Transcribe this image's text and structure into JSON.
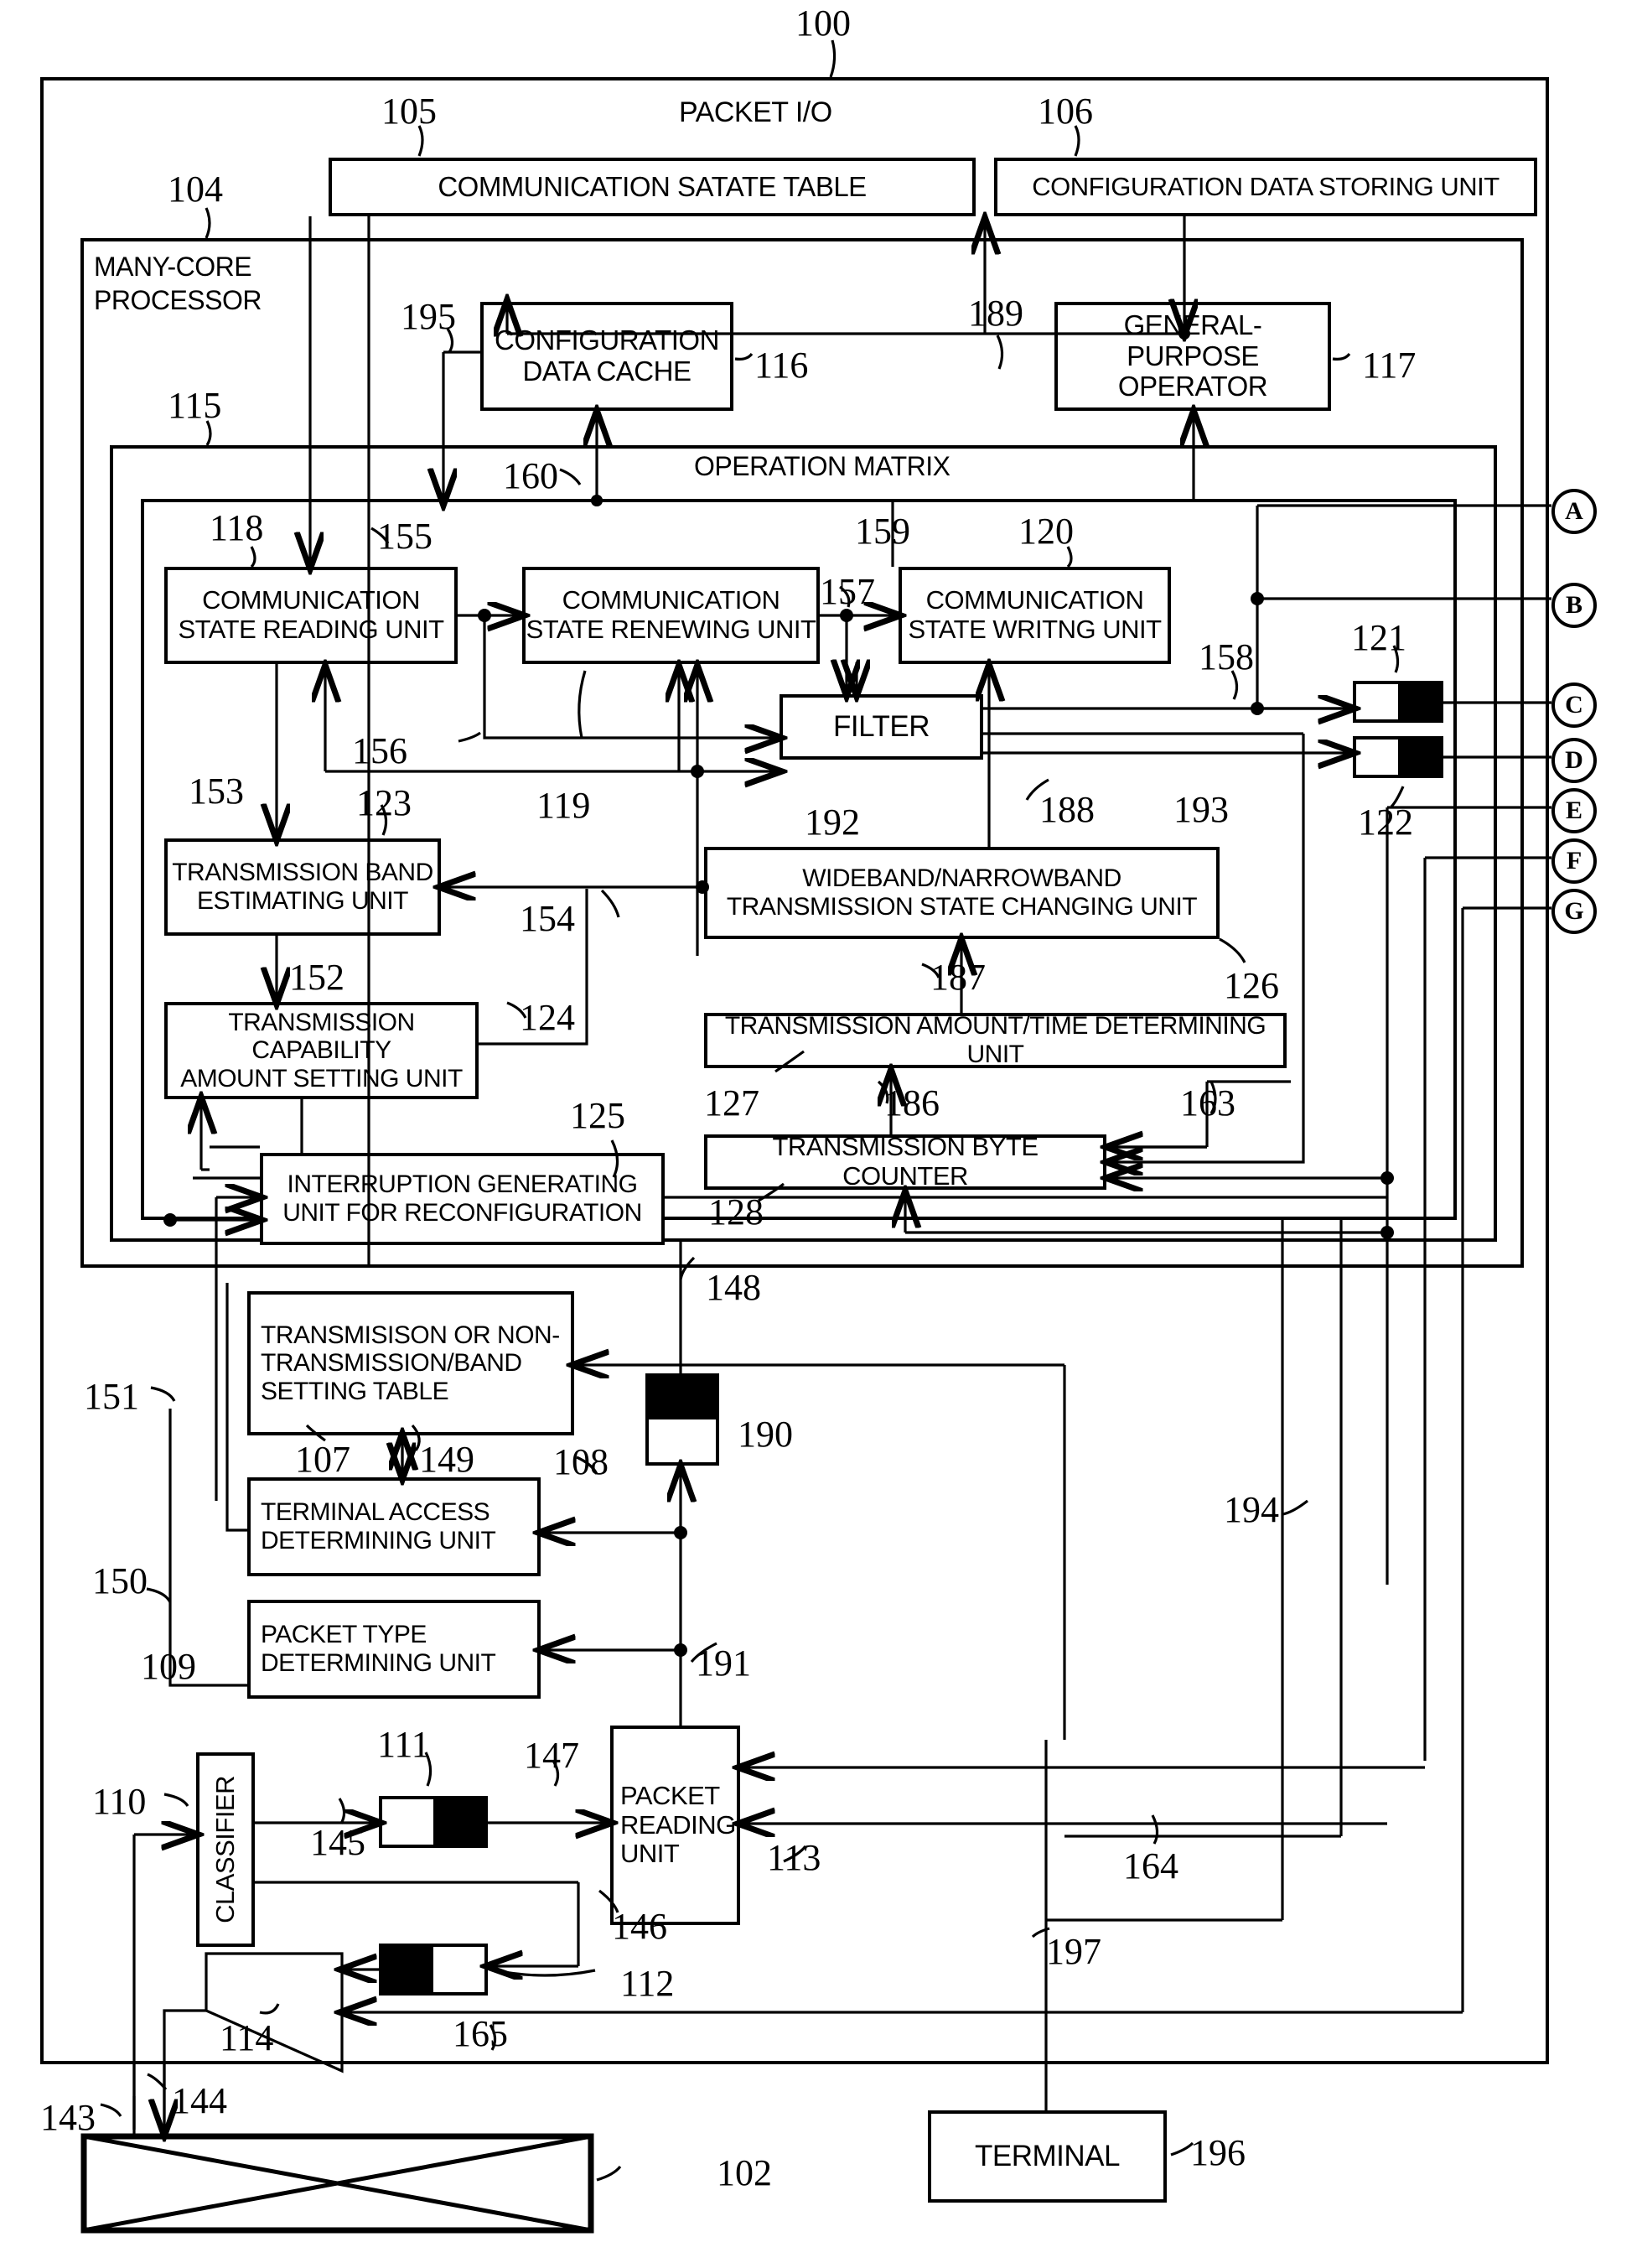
{
  "figure": {
    "top_ref": "100",
    "packet_io_label": "PACKET I/O",
    "many_core_label_line1": "MANY-CORE",
    "many_core_label_line2": "PROCESSOR",
    "operation_matrix_label": "OPERATION MATRIX"
  },
  "boxes": {
    "communication_state_table": "COMMUNICATION SATATE TABLE",
    "configuration_data_storing_unit": "CONFIGURATION DATA STORING UNIT",
    "configuration_data_cache_l1": "CONFIGURATION",
    "configuration_data_cache_l2": "DATA CACHE",
    "general_purpose_operator_l1": "GENERAL-PURPOSE",
    "general_purpose_operator_l2": "OPERATOR",
    "comm_state_reading_l1": "COMMUNICATION",
    "comm_state_reading_l2": "STATE READING UNIT",
    "comm_state_renewing_l1": "COMMUNICATION",
    "comm_state_renewing_l2": "STATE RENEWING UNIT",
    "comm_state_writing_l1": "COMMUNICATION",
    "comm_state_writing_l2": "STATE WRITNG UNIT",
    "filter": "FILTER",
    "transmission_band_estimating_l1": "TRANSMISSION BAND",
    "transmission_band_estimating_l2": "ESTIMATING UNIT",
    "transmission_capability_l1": "TRANSMISSION CAPABILITY",
    "transmission_capability_l2": "AMOUNT SETTING UNIT",
    "interruption_generating_l1": "INTERRUPTION GENERATING",
    "interruption_generating_l2": "UNIT FOR RECONFIGURATION",
    "wideband_narrowband_l1": "WIDEBAND/NARROWBAND",
    "wideband_narrowband_l2": "TRANSMISSION STATE CHANGING UNIT",
    "transmission_amount_time": "TRANSMISSION AMOUNT/TIME DETERMINING UNIT",
    "transmission_byte_counter": "TRANSMISSION BYTE COUNTER",
    "setting_table_l1": "TRANSMISISON OR NON-",
    "setting_table_l2": "TRANSMISSION/BAND",
    "setting_table_l3": "SETTING TABLE",
    "terminal_access_l1": "TERMINAL ACCESS",
    "terminal_access_l2": "DETERMINING UNIT",
    "packet_type_l1": "PACKET TYPE",
    "packet_type_l2": "DETERMINING UNIT",
    "classifier": "CLASSIFIER",
    "packet_reading_l1": "PACKET",
    "packet_reading_l2": "READING",
    "packet_reading_l3": "UNIT",
    "terminal": "TERMINAL"
  },
  "reference_numerals": {
    "n100": "100",
    "n102": "102",
    "n104": "104",
    "n105": "105",
    "n106": "106",
    "n107": "107",
    "n108": "108",
    "n109": "109",
    "n110": "110",
    "n111": "111",
    "n112": "112",
    "n113": "113",
    "n114": "114",
    "n115": "115",
    "n116": "116",
    "n117": "117",
    "n118": "118",
    "n119": "119",
    "n120": "120",
    "n121": "121",
    "n122": "122",
    "n123": "123",
    "n124": "124",
    "n125": "125",
    "n126": "126",
    "n127": "127",
    "n128": "128",
    "n143": "143",
    "n144": "144",
    "n145": "145",
    "n146": "146",
    "n147": "147",
    "n148": "148",
    "n149": "149",
    "n150": "150",
    "n151": "151",
    "n152": "152",
    "n153": "153",
    "n154": "154",
    "n155": "155",
    "n156": "156",
    "n157": "157",
    "n158": "158",
    "n159": "159",
    "n160": "160",
    "n163": "163",
    "n164": "164",
    "n165": "165",
    "n186": "186",
    "n187": "187",
    "n188": "188",
    "n189": "189",
    "n190": "190",
    "n191": "191",
    "n192": "192",
    "n193": "193",
    "n194": "194",
    "n195": "195",
    "n196": "196",
    "n197": "197"
  },
  "connector_tags": {
    "a": "A",
    "b": "B",
    "c": "C",
    "d": "D",
    "e": "E",
    "f": "F",
    "g": "G"
  },
  "colors": {
    "ink": "#000000",
    "paper": "#ffffff"
  }
}
